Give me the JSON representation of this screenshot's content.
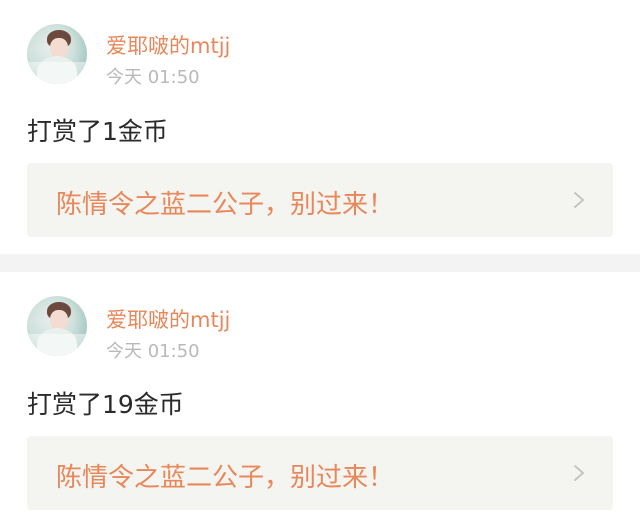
{
  "feed": [
    {
      "username": "爱耶啵的mtjj",
      "timestamp": "今天 01:50",
      "message": "打赏了1金币",
      "link_title": "陈情令之蓝二公子，别过来！"
    },
    {
      "username": "爱耶啵的mtjj",
      "timestamp": "今天 01:50",
      "message": "打赏了19金币",
      "link_title": "陈情令之蓝二公子，别过来！"
    }
  ],
  "icons": {
    "avatar": "avatar",
    "chevron": "chevron-right-icon"
  },
  "colors": {
    "accent": "#e8875a",
    "muted_text": "#b9b9b9",
    "body_text": "#2a2a2a",
    "link_box_bg": "#f4f4f0",
    "separator_bg": "#f3f3f3"
  }
}
